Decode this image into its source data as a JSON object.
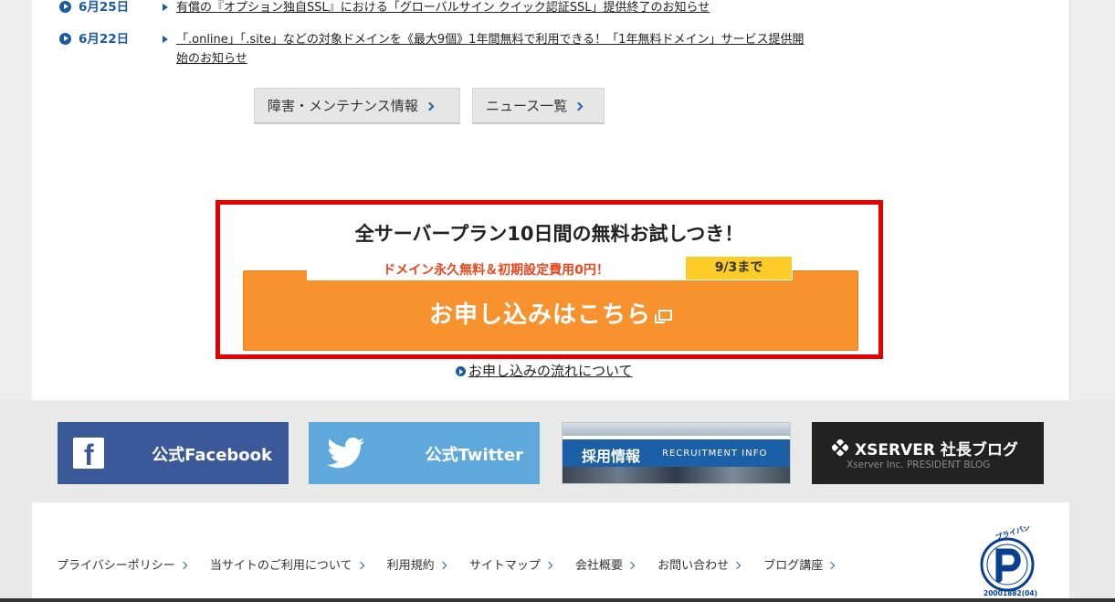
{
  "news": [
    {
      "date": "6月25日",
      "title": "有償の『オプション独自SSL』における「グローバルサイン クイック認証SSL」提供終了のお知らせ"
    },
    {
      "date": "6月22日",
      "title": "「.online」「.site」などの対象ドメインを《最大9個》1年間無料で利用できる！「1年無料ドメイン」サービス提供開始のお知らせ"
    }
  ],
  "buttons": {
    "maintenance": "障害・メンテナンス情報",
    "news_list": "ニュース一覧"
  },
  "promo": {
    "title": "全サーバープラン10日間の無料お試しつき！",
    "strip_text": "ドメイン永久無料＆初期設定費用0円！",
    "deadline": "9/3まで",
    "cta": "お申し込みはこちら",
    "flow_link": "お申し込みの流れについて"
  },
  "banners": {
    "facebook": "公式Facebook",
    "twitter": "公式Twitter",
    "recruit_title": "採用情報",
    "recruit_sub": "RECRUITMENT INFO",
    "blog_title": "XSERVER 社長ブログ",
    "blog_sub": "Xserver Inc. PRESIDENT BLOG"
  },
  "footer_links": [
    "プライバシーポリシー",
    "当サイトのご利用について",
    "利用規約",
    "サイトマップ",
    "会社概要",
    "お問い合わせ",
    "ブログ講座"
  ],
  "privacy_mark": {
    "text": "たいせつにしますプライバシー",
    "number": "20001882(04)"
  },
  "colors": {
    "accent_blue": "#1a5aa3",
    "cta_orange": "#f8922e",
    "highlight_red": "#e60000",
    "deadline_yellow": "#fbcc28"
  }
}
